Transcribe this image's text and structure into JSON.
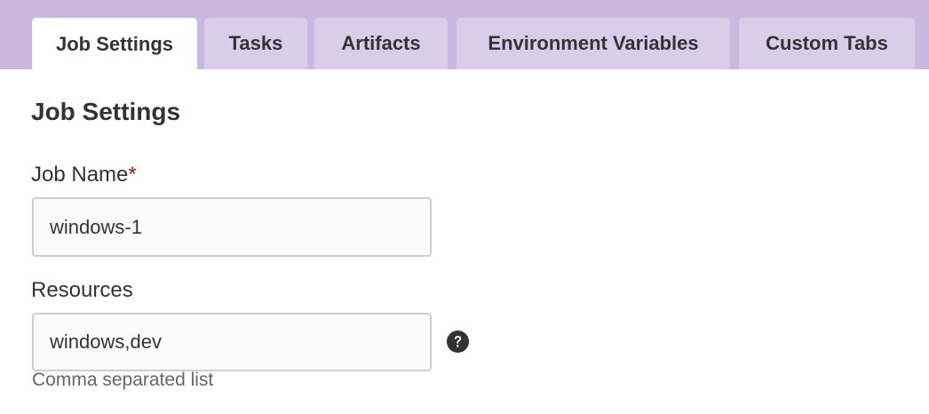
{
  "tabs": [
    {
      "label": "Job Settings",
      "active": true
    },
    {
      "label": "Tasks",
      "active": false
    },
    {
      "label": "Artifacts",
      "active": false
    },
    {
      "label": "Environment Variables",
      "active": false
    },
    {
      "label": "Custom Tabs",
      "active": false
    }
  ],
  "section": {
    "title": "Job Settings"
  },
  "job_name": {
    "label": "Job Name",
    "required_marker": "*",
    "value": "windows-1"
  },
  "resources": {
    "label": "Resources",
    "value": "windows,dev",
    "help_text": "Comma separated list",
    "help_icon": "question-circle-icon"
  },
  "colors": {
    "tab_bar_bg": "#cab8e0",
    "tab_bg": "#d9cdea",
    "active_tab_bg": "#ffffff",
    "required_marker": "#a0201d"
  }
}
